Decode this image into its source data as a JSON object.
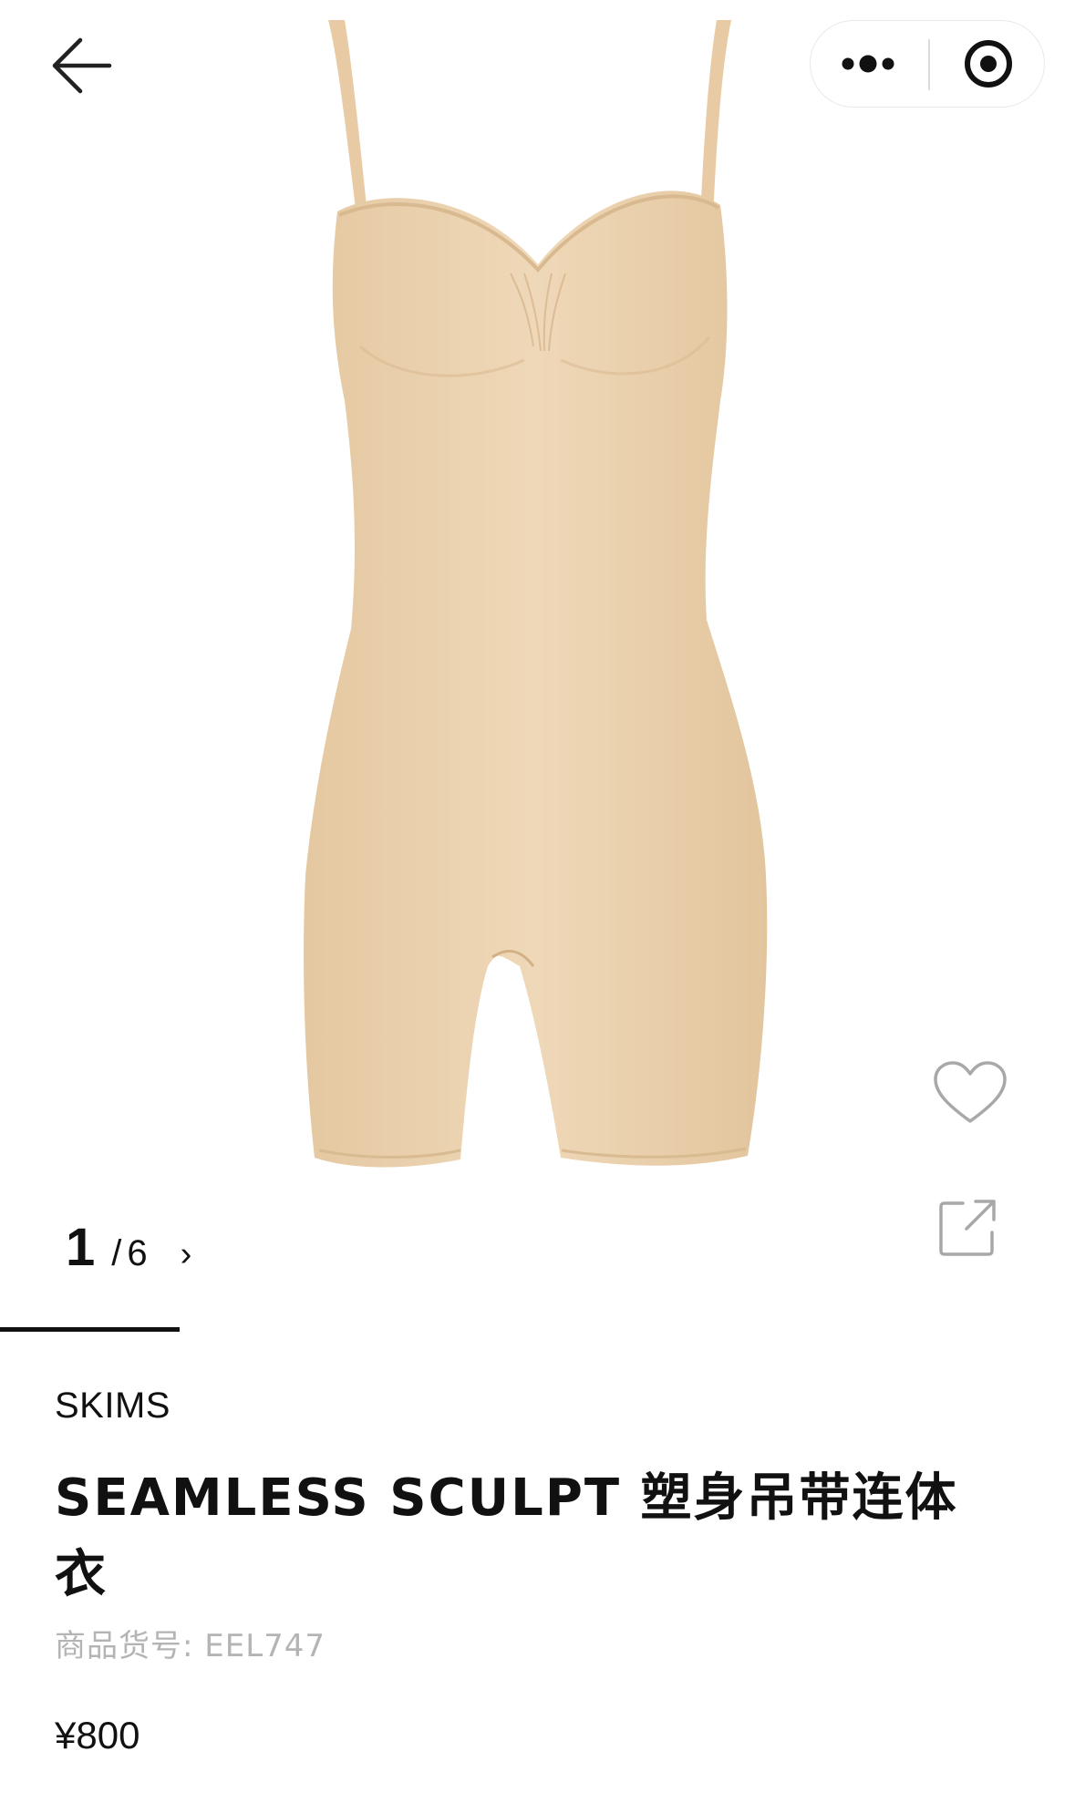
{
  "nav": {
    "back_icon": "arrow-left-icon",
    "capsule": {
      "more_icon": "more-dots-icon",
      "close_icon": "target-circle-icon"
    }
  },
  "gallery": {
    "current_page": "1",
    "separator": "/",
    "total_pages": "6",
    "next_icon": "›",
    "progress_fraction": 0.1667,
    "image_icon": "bodysuit-product-image",
    "product_color": "#EBD2AE"
  },
  "actions": {
    "favorite_icon": "heart-outline-icon",
    "share_icon": "share-external-icon"
  },
  "product": {
    "brand": "SKIMS",
    "title": "SEAMLESS SCULPT 塑身吊带连体衣",
    "sku": "商品货号: EEL747",
    "price": "¥800"
  }
}
